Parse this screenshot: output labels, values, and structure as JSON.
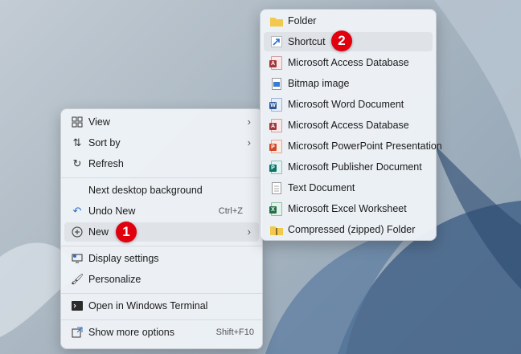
{
  "context_menu": {
    "items": {
      "view": "View",
      "sort_by": "Sort by",
      "refresh": "Refresh",
      "next_background": "Next desktop background",
      "undo_new": "Undo New",
      "undo_new_shortcut": "Ctrl+Z",
      "new": "New",
      "display_settings": "Display settings",
      "personalize": "Personalize",
      "open_terminal": "Open in Windows Terminal",
      "show_more": "Show more options",
      "show_more_shortcut": "Shift+F10"
    }
  },
  "new_submenu": {
    "items": [
      "Folder",
      "Shortcut",
      "Microsoft Access Database",
      "Bitmap image",
      "Microsoft Word Document",
      "Microsoft Access Database",
      "Microsoft PowerPoint Presentation",
      "Microsoft Publisher Document",
      "Text Document",
      "Microsoft Excel Worksheet",
      "Compressed (zipped) Folder"
    ]
  },
  "badges": {
    "one": "1",
    "two": "2"
  },
  "colors": {
    "badge": "#e0000e",
    "word": "#2b5797",
    "excel": "#1e7145",
    "access": "#a4373a",
    "powerpoint": "#d24726",
    "publisher": "#077568",
    "folder": "#f2c94c"
  }
}
